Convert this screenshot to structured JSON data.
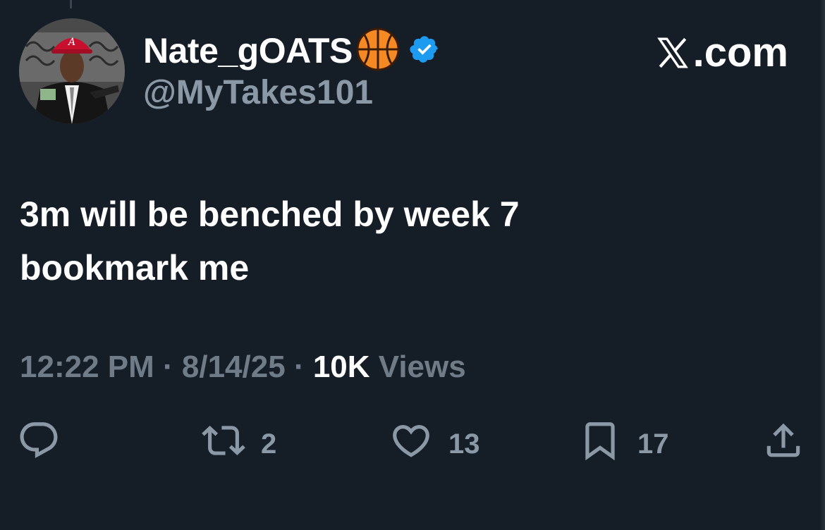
{
  "user": {
    "display_name": "Nate_gOATS",
    "handle": "@MyTakes101",
    "avatar_icon": "profile-avatar",
    "name_emoji": "basketball-icon",
    "verified": true
  },
  "brand": {
    "label": ".com"
  },
  "tweet": {
    "line1": "3m will be benched by week 7",
    "line2": "bookmark me",
    "time": "12:22 PM",
    "separator": "·",
    "date": "8/14/25",
    "views_count": "10K",
    "views_label": "Views"
  },
  "actions": {
    "reply": {
      "icon": "reply-icon",
      "count": ""
    },
    "retweet": {
      "icon": "retweet-icon",
      "count": "2"
    },
    "like": {
      "icon": "heart-icon",
      "count": "13"
    },
    "bookmark": {
      "icon": "bookmark-icon",
      "count": "17"
    },
    "share": {
      "icon": "share-icon",
      "count": ""
    }
  },
  "colors": {
    "background": "#151d27",
    "primary_text": "#ffffff",
    "secondary_text": "#8b98a5",
    "verified_blue": "#1d9bf0"
  }
}
